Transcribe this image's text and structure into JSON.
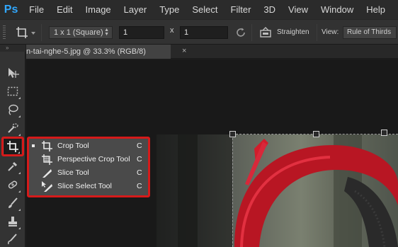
{
  "app": {
    "logo_text": "Ps",
    "accent": "#31a8ff"
  },
  "menu": [
    "File",
    "Edit",
    "Image",
    "Layer",
    "Type",
    "Select",
    "Filter",
    "3D",
    "View",
    "Window",
    "Help"
  ],
  "options": {
    "ratio_value": "1 x 1 (Square)",
    "width_value": "1",
    "x_label": "x",
    "height_value": "1",
    "straighten_label": "Straighten",
    "view_label": "View:",
    "view_value": "Rule of Thirds"
  },
  "toolbar": {
    "collapse_glyph": "»"
  },
  "document": {
    "tab_title": "n-tai-nghe-5.jpg @ 33.3% (RGB/8)",
    "close_glyph": "×"
  },
  "flyout": {
    "border_color": "#d51a1a",
    "items": [
      {
        "label": "Crop Tool",
        "shortcut": "C",
        "icon": "crop-icon",
        "selected": true
      },
      {
        "label": "Perspective Crop Tool",
        "shortcut": "C",
        "icon": "perspective-crop-icon",
        "selected": false
      },
      {
        "label": "Slice Tool",
        "shortcut": "C",
        "icon": "slice-icon",
        "selected": false
      },
      {
        "label": "Slice Select Tool",
        "shortcut": "C",
        "icon": "slice-select-icon",
        "selected": false
      }
    ]
  }
}
